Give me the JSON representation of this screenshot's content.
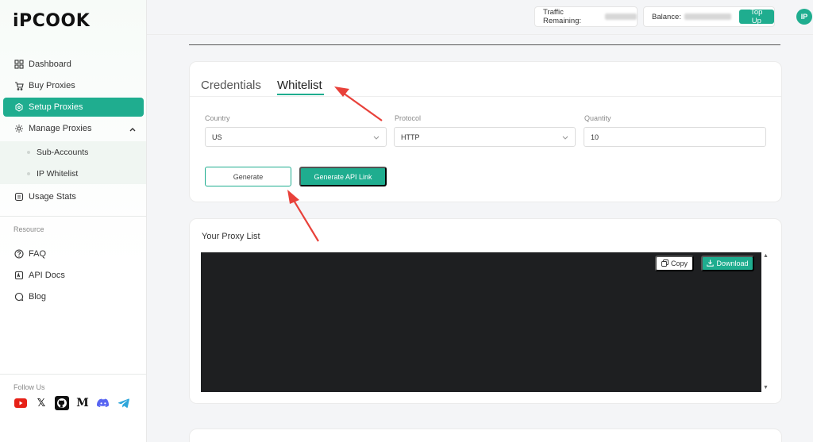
{
  "brand": {
    "logo_text": "iPCOOK"
  },
  "sidebar": {
    "items": [
      {
        "label": "Dashboard",
        "icon": "grid-icon"
      },
      {
        "label": "Buy Proxies",
        "icon": "cart-icon"
      },
      {
        "label": "Setup Proxies",
        "icon": "box-icon",
        "active": true
      },
      {
        "label": "Manage Proxies",
        "icon": "gear-icon",
        "expanded": true
      },
      {
        "label": "Usage Stats",
        "icon": "stats-icon"
      }
    ],
    "sub_items": [
      {
        "label": "Sub-Accounts"
      },
      {
        "label": "IP Whitelist"
      }
    ],
    "resource_label": "Resource",
    "resource_items": [
      {
        "label": "FAQ",
        "icon": "question-icon"
      },
      {
        "label": "API Docs",
        "icon": "api-icon"
      },
      {
        "label": "Blog",
        "icon": "chat-icon"
      }
    ],
    "follow_label": "Follow Us"
  },
  "topbar": {
    "traffic_label": "Traffic Remaining:",
    "balance_label": "Balance:",
    "topup_label": "Top Up",
    "avatar_text": "IP"
  },
  "setup": {
    "tabs": [
      {
        "label": "Credentials"
      },
      {
        "label": "Whitelist",
        "active": true
      }
    ],
    "country_label": "Country",
    "country_value": "US",
    "protocol_label": "Protocol",
    "protocol_value": "HTTP",
    "quantity_label": "Quantity",
    "quantity_value": "10",
    "generate_label": "Generate",
    "generate_api_label": "Generate API Link"
  },
  "proxy_list": {
    "title": "Your Proxy List",
    "copy_label": "Copy",
    "download_label": "Download"
  },
  "colors": {
    "accent": "#1fad8f",
    "terminal_bg": "#1e1f21",
    "annotation": "#e8413a"
  }
}
